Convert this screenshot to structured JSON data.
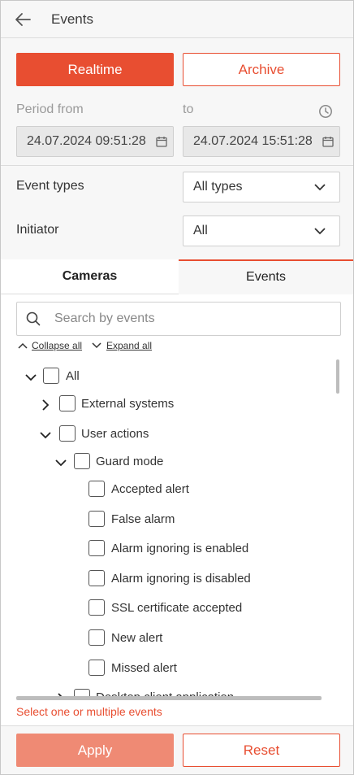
{
  "header": {
    "title": "Events",
    "back_icon": "arrow-left-icon"
  },
  "mode_buttons": {
    "realtime": "Realtime",
    "archive": "Archive"
  },
  "period": {
    "from_label": "Period from",
    "to_label": "to",
    "from_value": "24.07.2024 09:51:28",
    "to_value": "24.07.2024 15:51:28"
  },
  "filters": {
    "event_types_label": "Event types",
    "event_types_value": "All types",
    "initiator_label": "Initiator",
    "initiator_value": "All"
  },
  "tabs": {
    "cameras": "Cameras",
    "events": "Events"
  },
  "search": {
    "placeholder": "Search by events"
  },
  "tree_controls": {
    "collapse_all": "Collapse all",
    "expand_all": "Expand all"
  },
  "tree": {
    "all": "All",
    "external_systems": "External systems",
    "user_actions": "User actions",
    "guard_mode": "Guard mode",
    "items": [
      "Accepted alert",
      "False alarm",
      "Alarm ignoring is enabled",
      "Alarm ignoring is disabled",
      "SSL certificate accepted",
      "New alert",
      "Missed alert"
    ],
    "partial_next": "Desktop client application"
  },
  "hint": "Select one or multiple events",
  "footer": {
    "apply": "Apply",
    "reset": "Reset"
  },
  "colors": {
    "accent": "#e84e31",
    "accent_disabled": "#ef8a74",
    "muted": "#9a9a9a"
  }
}
